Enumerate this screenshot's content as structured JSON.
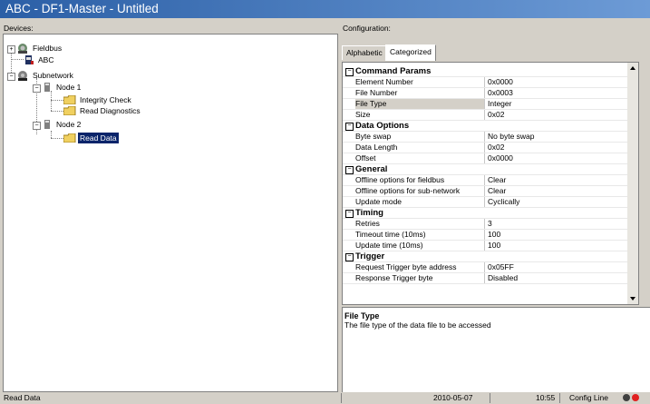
{
  "window": {
    "title": "ABC - DF1-Master - Untitled"
  },
  "devices_panel": {
    "label": "Devices:",
    "tree": {
      "fieldbus": "Fieldbus",
      "abc": "ABC",
      "subnetwork": "Subnetwork",
      "node1": "Node 1",
      "integrity_check": "Integrity Check",
      "read_diagnostics": "Read Diagnostics",
      "node2": "Node 2",
      "read_data": "Read Data"
    },
    "expander_plus": "+",
    "expander_minus": "−"
  },
  "config_panel": {
    "label": "Configuration:",
    "tabs": [
      "Alphabetic",
      "Categorized"
    ],
    "active_tab": "Categorized",
    "collapse_glyph": "−",
    "categories": [
      {
        "name": "Command Params",
        "rows": [
          {
            "key": "Element Number",
            "value": "0x0000"
          },
          {
            "key": "File Number",
            "value": "0x0003"
          },
          {
            "key": "File Type",
            "value": "Integer"
          },
          {
            "key": "Size",
            "value": "0x02"
          }
        ]
      },
      {
        "name": "Data Options",
        "rows": [
          {
            "key": "Byte swap",
            "value": "No byte swap"
          },
          {
            "key": "Data Length",
            "value": "0x02"
          },
          {
            "key": "Offset",
            "value": "0x0000"
          }
        ]
      },
      {
        "name": "General",
        "rows": [
          {
            "key": "Offline options for fieldbus",
            "value": "Clear"
          },
          {
            "key": "Offline options for sub-network",
            "value": "Clear"
          },
          {
            "key": "Update mode",
            "value": "Cyclically"
          }
        ]
      },
      {
        "name": "Timing",
        "rows": [
          {
            "key": "Retries",
            "value": "3"
          },
          {
            "key": "Timeout time (10ms)",
            "value": "100"
          },
          {
            "key": "Update time (10ms)",
            "value": "100"
          }
        ]
      },
      {
        "name": "Trigger",
        "rows": [
          {
            "key": "Request Trigger byte address",
            "value": "0x05FF"
          },
          {
            "key": "Response Trigger byte",
            "value": "Disabled"
          }
        ]
      }
    ],
    "selected_key": "File Type"
  },
  "description": {
    "title": "File Type",
    "text": "The file type of the data file to be accessed"
  },
  "status_bar": {
    "left": "Read Data",
    "date": "2010-05-07",
    "time": "10:55",
    "config_line": "Config Line"
  },
  "colors": {
    "title_bar": "#2b5fa6",
    "selection": "#0a246a",
    "led_red": "#e02020",
    "led_dark": "#404040"
  }
}
